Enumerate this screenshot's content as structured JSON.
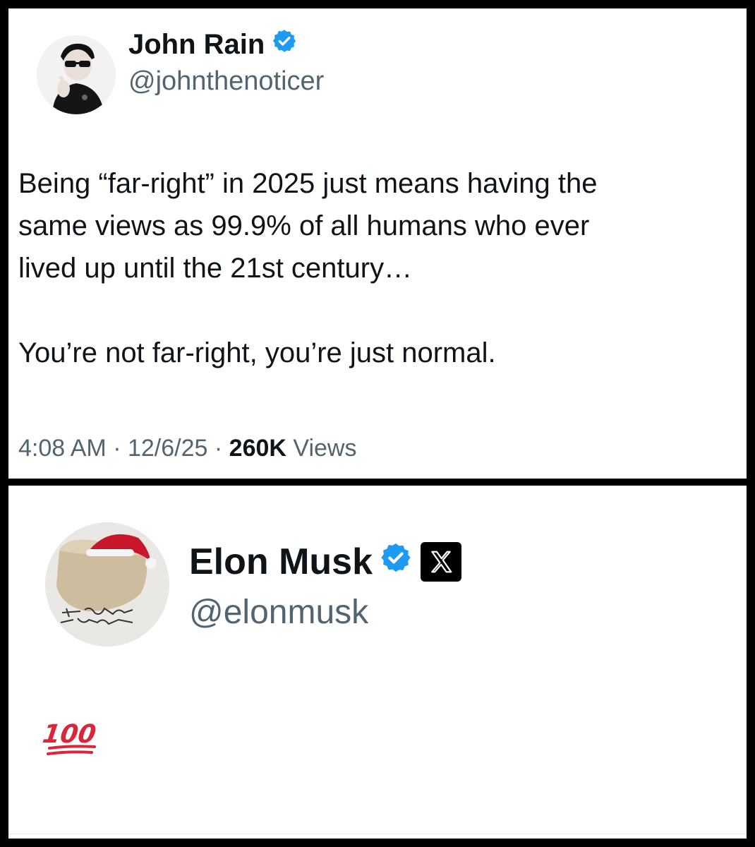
{
  "tweet": {
    "author_name": "John Rain",
    "author_handle": "@johnthenoticer",
    "verified": true,
    "body_lines": [
      "Being “far-right” in 2025 just means having the",
      "same views as 99.9% of all humans who ever",
      "lived up until the 21st century…",
      "You’re not far-right, you’re just normal."
    ],
    "time": "4:08 AM",
    "date": "12/6/25",
    "separator": "·",
    "views_count": "260K",
    "views_label": "Views"
  },
  "reply": {
    "author_name": "Elon Musk",
    "author_handle": "@elonmusk",
    "verified": true,
    "affiliate_badge_icon": "x-logo-icon",
    "body_emoji": "💯"
  },
  "colors": {
    "verified_blue": "#1d9bf0",
    "text_primary": "#0f1419",
    "text_secondary": "#536471",
    "background": "#ffffff",
    "frame": "#000000"
  }
}
